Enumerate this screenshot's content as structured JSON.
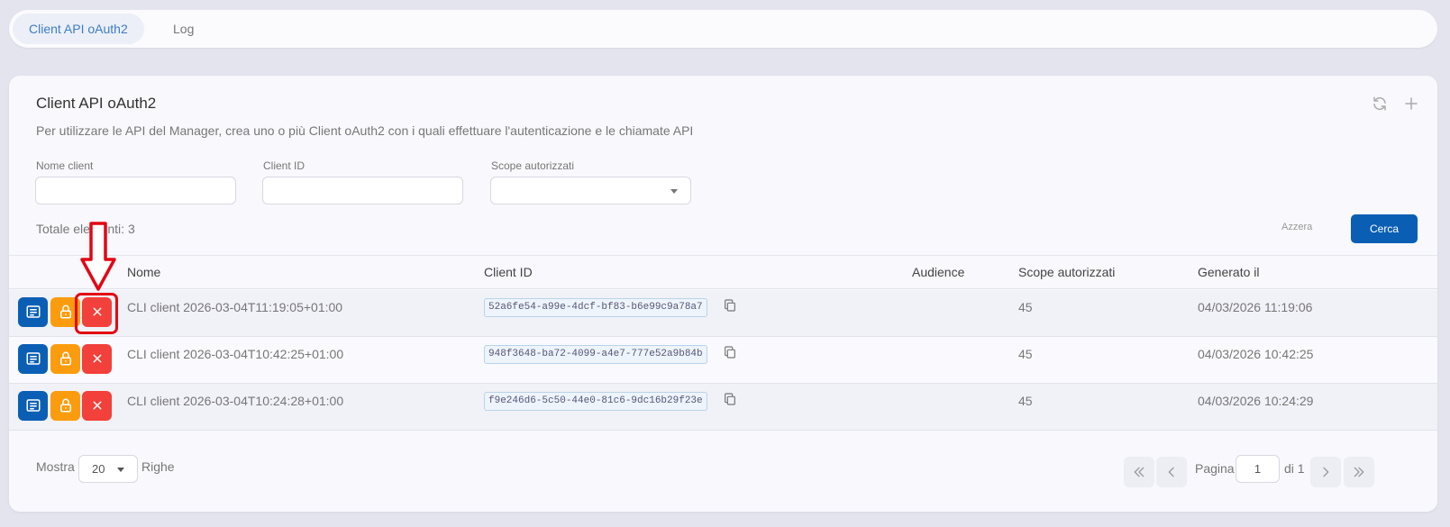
{
  "tabs": [
    {
      "label": "Client API oAuth2",
      "active": true
    },
    {
      "label": "Log",
      "active": false
    }
  ],
  "card": {
    "title": "Client API oAuth2",
    "subtitle": "Per utilizzare le API del Manager, crea uno o più Client oAuth2 con i quali effettuare l'autenticazione e le chiamate API",
    "refresh_icon": "refresh-icon",
    "add_icon": "plus-icon"
  },
  "filters": {
    "name_label": "Nome client",
    "name_value": "",
    "client_id_label": "Client ID",
    "client_id_value": "",
    "scope_label": "Scope autorizzati",
    "scope_value": ""
  },
  "total_text": "Totale elementi: 3",
  "buttons": {
    "reset_label": "Azzera",
    "search_label": "Cerca"
  },
  "table": {
    "columns": [
      "Nome",
      "Client ID",
      "Audience",
      "Scope autorizzati",
      "Generato il"
    ],
    "rows": [
      {
        "name": "CLI client 2026-03-04T11:19:05+01:00",
        "client_id": "52a6fe54-a99e-4dcf-bf83-b6e99c9a78a7",
        "audience": "",
        "scopes": "45",
        "generated": "04/03/2026 11:19:06"
      },
      {
        "name": "CLI client 2026-03-04T10:42:25+01:00",
        "client_id": "948f3648-ba72-4099-a4e7-777e52a9b84b",
        "audience": "",
        "scopes": "45",
        "generated": "04/03/2026 10:42:25"
      },
      {
        "name": "CLI client 2026-03-04T10:24:28+01:00",
        "client_id": "f9e246d6-5c50-44e0-81c6-9dc16b29f23e",
        "audience": "",
        "scopes": "45",
        "generated": "04/03/2026 10:24:29"
      }
    ],
    "row_actions": [
      "list-icon",
      "lock-icon",
      "close-icon"
    ]
  },
  "pagination": {
    "show_label": "Mostra",
    "page_size": "20",
    "rows_label": "Righe",
    "page_label": "Pagina",
    "current_page": "1",
    "of_label": "di 1"
  },
  "colors": {
    "primary": "#0a5fb4",
    "lock": "#fb9c0e",
    "delete": "#f2403a",
    "annotation": "#e30613"
  }
}
